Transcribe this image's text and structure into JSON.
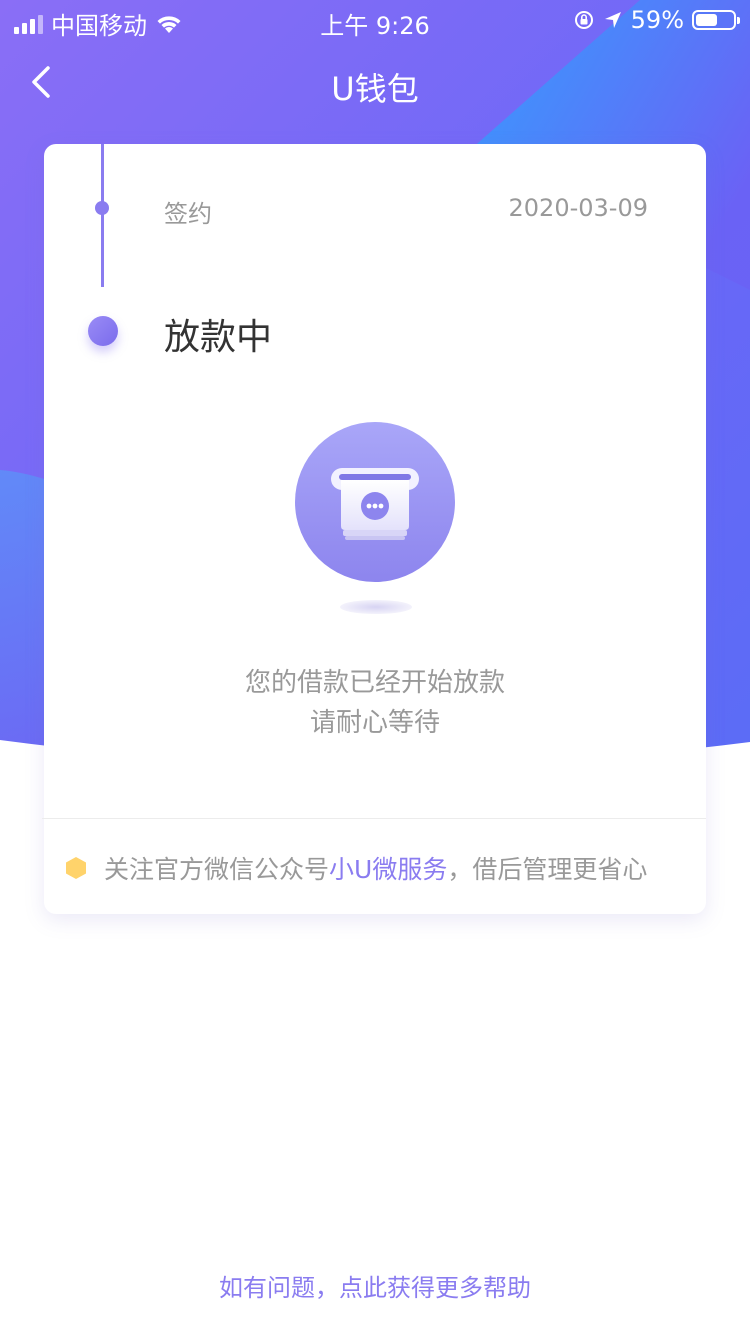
{
  "status_bar": {
    "carrier": "中国移动",
    "time": "上午 9:26",
    "battery_percent": "59%",
    "battery_level": 0.59,
    "icons": [
      "signal-icon",
      "wifi-icon",
      "rotation-lock-icon",
      "location-icon",
      "battery-icon"
    ]
  },
  "nav": {
    "title": "U钱包",
    "back_icon": "chevron-left-icon"
  },
  "timeline": {
    "steps": [
      {
        "label": "签约",
        "date": "2020-03-09",
        "state": "done"
      },
      {
        "label": "放款中",
        "state": "current"
      }
    ]
  },
  "status_message": {
    "illustration": "receipt-printer-icon",
    "line1": "您的借款已经开始放款",
    "line2": "请耐心等待"
  },
  "follow": {
    "icon": "hexagon-icon",
    "prefix": "关注官方微信公众号",
    "link": "小U微服务",
    "suffix": "，借后管理更省心"
  },
  "help_link": "如有问题，点此获得更多帮助",
  "colors": {
    "accent": "#8a7cf0",
    "gradient_start": "#7b6bf5",
    "gradient_end": "#4d8ff8",
    "hex_icon": "#ffd36b"
  }
}
